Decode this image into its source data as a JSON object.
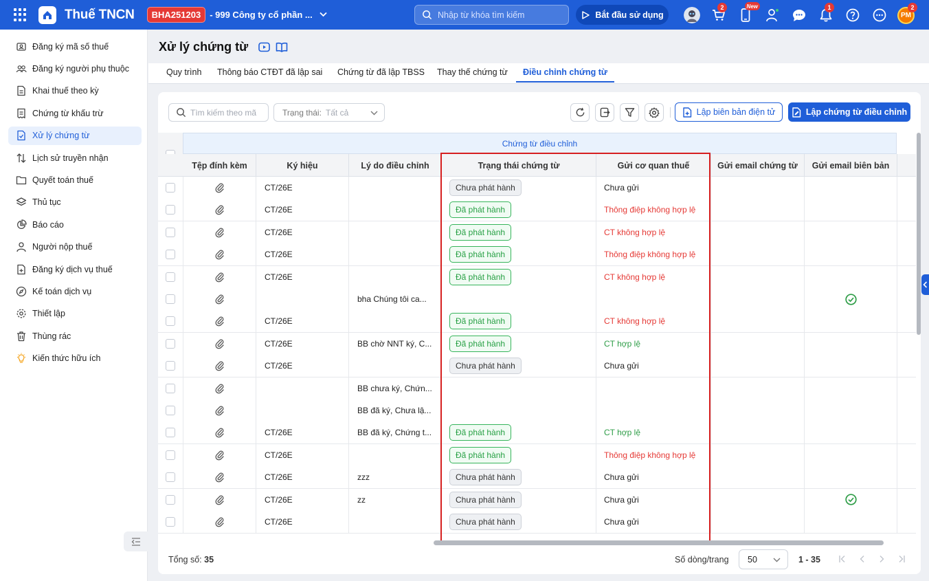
{
  "header": {
    "app_name": "Thuế TNCN",
    "code_badge": "BHA251203",
    "company": "- 999 Công ty cổ phần ...",
    "search_placeholder": "Nhập từ khóa tìm kiếm",
    "start_label": "Bắt đầu sử dụng",
    "cart_badge": "2",
    "new_badge": "New",
    "notif_badge": "1",
    "user_badge": "2",
    "user_initials": "PM"
  },
  "sidebar": {
    "items": [
      {
        "label": "Đăng ký mã số thuế",
        "icon": "id-card-icon"
      },
      {
        "label": "Đăng ký người phụ thuộc",
        "icon": "users-icon"
      },
      {
        "label": "Khai thuế theo kỳ",
        "icon": "document-icon"
      },
      {
        "label": "Chứng từ khấu trừ",
        "icon": "receipt-icon"
      },
      {
        "label": "Xử lý chứng từ",
        "icon": "document-check-icon",
        "active": true
      },
      {
        "label": "Lịch sử truyền nhận",
        "icon": "transfer-icon"
      },
      {
        "label": "Quyết toán thuế",
        "icon": "folder-icon"
      },
      {
        "label": "Thủ tục",
        "icon": "layers-icon"
      },
      {
        "label": "Báo cáo",
        "icon": "pie-chart-icon"
      },
      {
        "label": "Người nộp thuế",
        "icon": "person-icon"
      },
      {
        "label": "Đăng ký dịch vụ thuế",
        "icon": "file-plus-icon"
      },
      {
        "label": "Kế toán dịch vụ",
        "icon": "compass-icon"
      },
      {
        "label": "Thiết lập",
        "icon": "gear-icon"
      },
      {
        "label": "Thùng rác",
        "icon": "trash-icon"
      },
      {
        "label": "Kiến thức hữu ích",
        "icon": "lightbulb-icon"
      }
    ]
  },
  "page": {
    "title": "Xử lý chứng từ",
    "tabs": [
      "Quy trình",
      "Thông báo CTĐT đã lập sai",
      "Chứng từ đã lập TBSS",
      "Thay thế chứng từ",
      "Điều chỉnh chứng từ"
    ],
    "active_tab": "Điều chỉnh chứng từ"
  },
  "toolbar": {
    "search_placeholder": "Tìm kiếm theo mã",
    "status_label": "Trạng thái:",
    "status_value": "Tất cả",
    "report_button": "Lập biên bản điện tử",
    "create_button": "Lập chứng từ điều chỉnh"
  },
  "table": {
    "group_header": "Chứng từ điều chỉnh",
    "columns": [
      "Tệp đính kèm",
      "Ký hiệu",
      "Lý do điều chỉnh",
      "Trạng thái chứng từ",
      "Gửi cơ quan thuế",
      "Gửi email chứng từ",
      "Gửi email biên bản"
    ],
    "rows": [
      {
        "symbol": "CT/26E",
        "reason": "",
        "status": "Chưa phát hành",
        "status_type": "gray",
        "tax": "Chưa gửi",
        "tax_type": "normal",
        "email_report": false
      },
      {
        "symbol": "CT/26E",
        "reason": "",
        "status": "Đã phát hành",
        "status_type": "green",
        "tax": "Thông điệp không hợp lệ",
        "tax_type": "red",
        "email_report": false
      },
      {
        "symbol": "CT/26E",
        "reason": "",
        "status": "Đã phát hành",
        "status_type": "green",
        "tax": "CT không hợp lệ",
        "tax_type": "red",
        "email_report": false
      },
      {
        "symbol": "CT/26E",
        "reason": "",
        "status": "Đã phát hành",
        "status_type": "green",
        "tax": "Thông điệp không hợp lệ",
        "tax_type": "red",
        "email_report": false
      },
      {
        "symbol": "CT/26E",
        "reason": "",
        "status": "Đã phát hành",
        "status_type": "green",
        "tax": "CT không hợp lệ",
        "tax_type": "red",
        "email_report": false
      },
      {
        "symbol": "",
        "reason": "bha Chúng tôi ca...",
        "status": "",
        "status_type": "",
        "tax": "",
        "tax_type": "normal",
        "email_report": true
      },
      {
        "symbol": "CT/26E",
        "reason": "",
        "status": "Đã phát hành",
        "status_type": "green",
        "tax": "CT không hợp lệ",
        "tax_type": "red",
        "email_report": false
      },
      {
        "symbol": "CT/26E",
        "reason": "BB chờ NNT ký, C...",
        "status": "Đã phát hành",
        "status_type": "green",
        "tax": "CT hợp lệ",
        "tax_type": "green",
        "email_report": false
      },
      {
        "symbol": "CT/26E",
        "reason": "",
        "status": "Chưa phát hành",
        "status_type": "gray",
        "tax": "Chưa gửi",
        "tax_type": "normal",
        "email_report": false
      },
      {
        "symbol": "",
        "reason": "BB chưa ký, Chứn...",
        "status": "",
        "status_type": "",
        "tax": "",
        "tax_type": "normal",
        "email_report": false
      },
      {
        "symbol": "",
        "reason": "BB đã ký, Chưa lậ...",
        "status": "",
        "status_type": "",
        "tax": "",
        "tax_type": "normal",
        "email_report": false
      },
      {
        "symbol": "CT/26E",
        "reason": "BB đã ký, Chứng t...",
        "status": "Đã phát hành",
        "status_type": "green",
        "tax": "CT hợp lệ",
        "tax_type": "green",
        "email_report": false
      },
      {
        "symbol": "CT/26E",
        "reason": "",
        "status": "Đã phát hành",
        "status_type": "green",
        "tax": "Thông điệp không hợp lệ",
        "tax_type": "red",
        "email_report": false
      },
      {
        "symbol": "CT/26E",
        "reason": "zzz",
        "status": "Chưa phát hành",
        "status_type": "gray",
        "tax": "Chưa gửi",
        "tax_type": "normal",
        "email_report": false
      },
      {
        "symbol": "CT/26E",
        "reason": "zz",
        "status": "Chưa phát hành",
        "status_type": "gray",
        "tax": "Chưa gửi",
        "tax_type": "normal",
        "email_report": true
      },
      {
        "symbol": "CT/26E",
        "reason": "",
        "status": "Chưa phát hành",
        "status_type": "gray",
        "tax": "Chưa gửi",
        "tax_type": "normal",
        "email_report": false
      }
    ]
  },
  "footer": {
    "total_label": "Tổng số:",
    "total_value": "35",
    "rows_per_page_label": "Số dòng/trang",
    "rows_per_page_value": "50",
    "range": "1 - 35"
  },
  "colors": {
    "primary": "#1f5ed8",
    "red": "#e53935",
    "green": "#2e9d47",
    "highlight_box": "#d61f1f"
  }
}
